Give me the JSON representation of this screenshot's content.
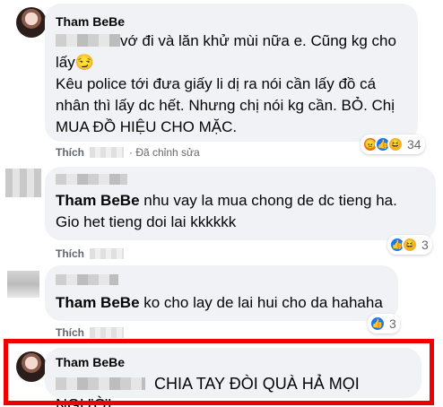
{
  "comment1": {
    "author": "Tham BeBe",
    "line1": "vớ đi và lăn khử mùi nữa e. Cũng kg cho",
    "line2": "lấy😏",
    "line3": "Kêu police tới đưa giấy li dị ra nói cần lấy đồ cá",
    "line4": "nhân thì lấy dc hết. Nhưng chị nói kg cần. BỎ. Chị",
    "line5": "MUA ĐỒ HIỆU CHO MẶC.",
    "like_label": "Thích",
    "edited": "· Đã chỉnh sửa",
    "reaction_count": "34",
    "reactions": [
      "angry-icon",
      "like-icon",
      "haha-icon"
    ]
  },
  "reply1": {
    "author": "Tham BeBe",
    "text_after_name": " nhu vay la mua chong de dc tieng ha.",
    "line2": "Gio het tieng doi lai kkkkkk",
    "like_label": "Thích",
    "reaction_count": "3",
    "reactions": [
      "like-icon",
      "haha-icon"
    ]
  },
  "reply2": {
    "author": "Tham BeBe",
    "text_after_name": " ko cho lay de lai hui cho da hahaha",
    "like_label": "Thích",
    "reaction_count": "3",
    "reactions": [
      "like-icon"
    ]
  },
  "comment2": {
    "author": "Tham BeBe",
    "text": "CHIA TAY ĐÒI QUÀ HẢ MỌI NGƯỜI."
  },
  "colors": {
    "highlight": "#ee0000",
    "bubble": "#f0f2f5",
    "like_blue": "#1877f2"
  }
}
